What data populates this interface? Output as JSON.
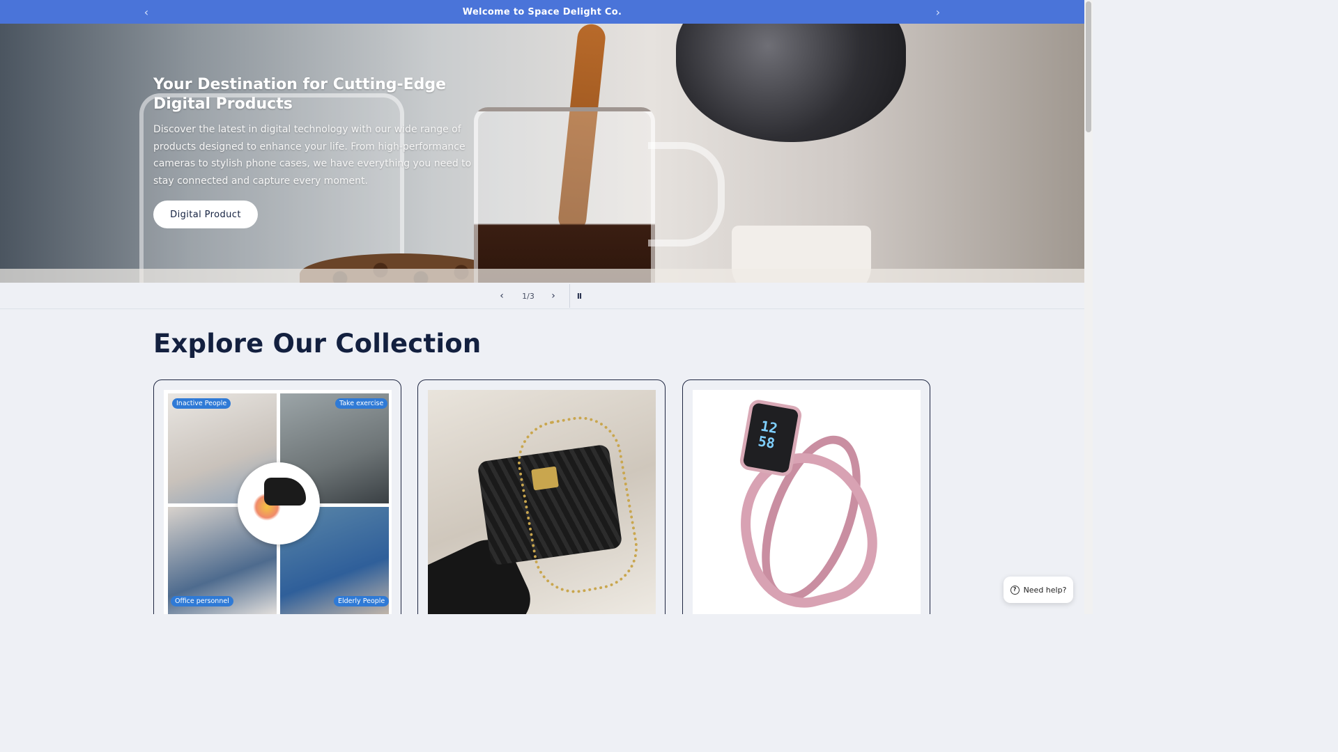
{
  "announcement": {
    "message": "Welcome to Space Delight Co.",
    "prev_icon": "chevron-left",
    "next_icon": "chevron-right"
  },
  "hero": {
    "title": "Your Destination for Cutting-Edge Digital Products",
    "description": "Discover the latest in digital technology with our wide range of products designed to enhance your life. From high-performance cameras to stylish phone cases, we have everything you need to stay connected and capture every moment.",
    "button_label": "Digital Product"
  },
  "slider": {
    "counter": "1/3",
    "prev_symbol": "‹",
    "next_symbol": "›",
    "pause_symbol": "II"
  },
  "collection": {
    "title": "Explore Our Collection",
    "cards": [
      {
        "tags": [
          "Inactive People",
          "Take exercise",
          "Office personnel",
          "Elderly People"
        ]
      },
      {},
      {
        "watch_time": "12\n58"
      }
    ]
  },
  "help": {
    "label": "Need help?",
    "icon_symbol": "?"
  },
  "colors": {
    "announcement_bg": "#4a74d9",
    "heading": "#13203f",
    "page_bg": "#eef0f5"
  }
}
